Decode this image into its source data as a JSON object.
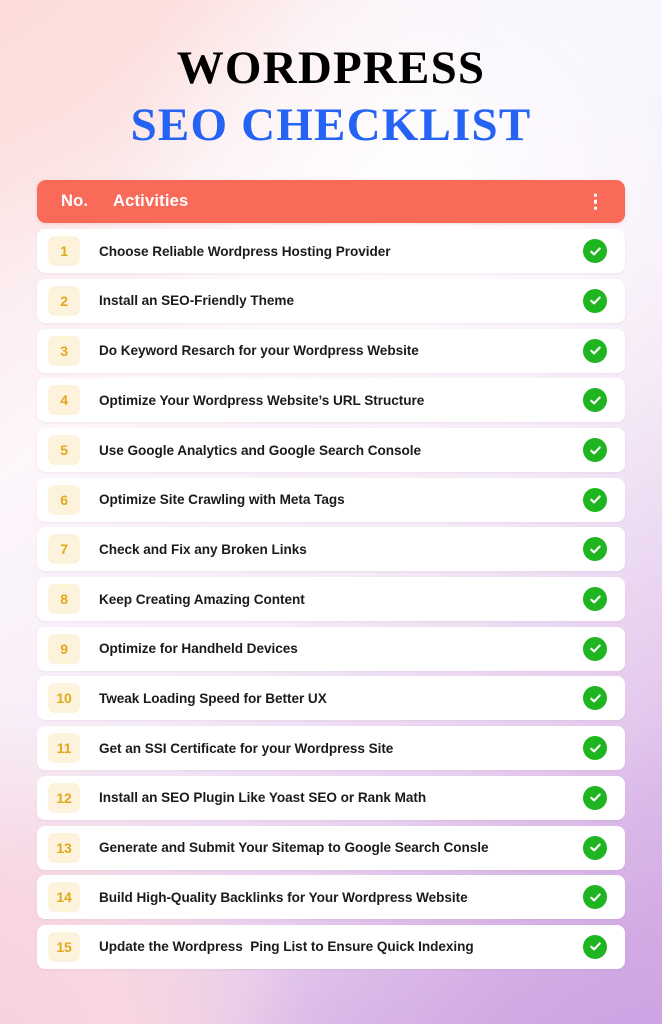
{
  "title": {
    "line1": "WORDPRESS",
    "line2": "SEO CHECKLIST",
    "line1_color": "#000000",
    "line2_color": "#2563f5"
  },
  "table": {
    "header": {
      "col_no": "No.",
      "col_activities": "Activities",
      "menu_icon": "kebab-menu-icon",
      "background_color": "#fa6a58",
      "text_color": "#ffffff"
    },
    "check_icon": "check-circle-icon",
    "check_color": "#1fb521",
    "badge_background": "#fdf2dc",
    "badge_text_color": "#e0a81b",
    "rows": [
      {
        "no": "1",
        "activity": "Choose Reliable Wordpress Hosting Provider",
        "checked": true
      },
      {
        "no": "2",
        "activity": "Install an SEO-Friendly Theme",
        "checked": true
      },
      {
        "no": "3",
        "activity": "Do Keyword Resarch for your Wordpress Website",
        "checked": true
      },
      {
        "no": "4",
        "activity": "Optimize Your Wordpress Website’s URL Structure",
        "checked": true
      },
      {
        "no": "5",
        "activity": "Use Google Analytics and Google Search Console",
        "checked": true
      },
      {
        "no": "6",
        "activity": "Optimize Site Crawling with Meta Tags",
        "checked": true
      },
      {
        "no": "7",
        "activity": "Check and Fix any Broken Links",
        "checked": true
      },
      {
        "no": "8",
        "activity": "Keep Creating Amazing Content",
        "checked": true
      },
      {
        "no": "9",
        "activity": "Optimize for Handheld Devices",
        "checked": true
      },
      {
        "no": "10",
        "activity": "Tweak Loading Speed for Better UX",
        "checked": true
      },
      {
        "no": "11",
        "activity": "Get an SSI Certificate for your Wordpress Site",
        "checked": true
      },
      {
        "no": "12",
        "activity": "Install an SEO Plugin Like Yoast SEO or Rank Math",
        "checked": true
      },
      {
        "no": "13",
        "activity": "Generate and Submit Your Sitemap to Google Search Consle",
        "checked": true
      },
      {
        "no": "14",
        "activity": "Build High-Quality Backlinks for Your Wordpress Website",
        "checked": true
      },
      {
        "no": "15",
        "activity": "Update the Wordpress  Ping List to Ensure Quick Indexing",
        "checked": true
      }
    ]
  },
  "background": {
    "top_left": "#fcdcdb",
    "top_right": "#fbfaff",
    "bottom_left": "#f6cfdc",
    "bottom_right": "#c39ae2"
  }
}
